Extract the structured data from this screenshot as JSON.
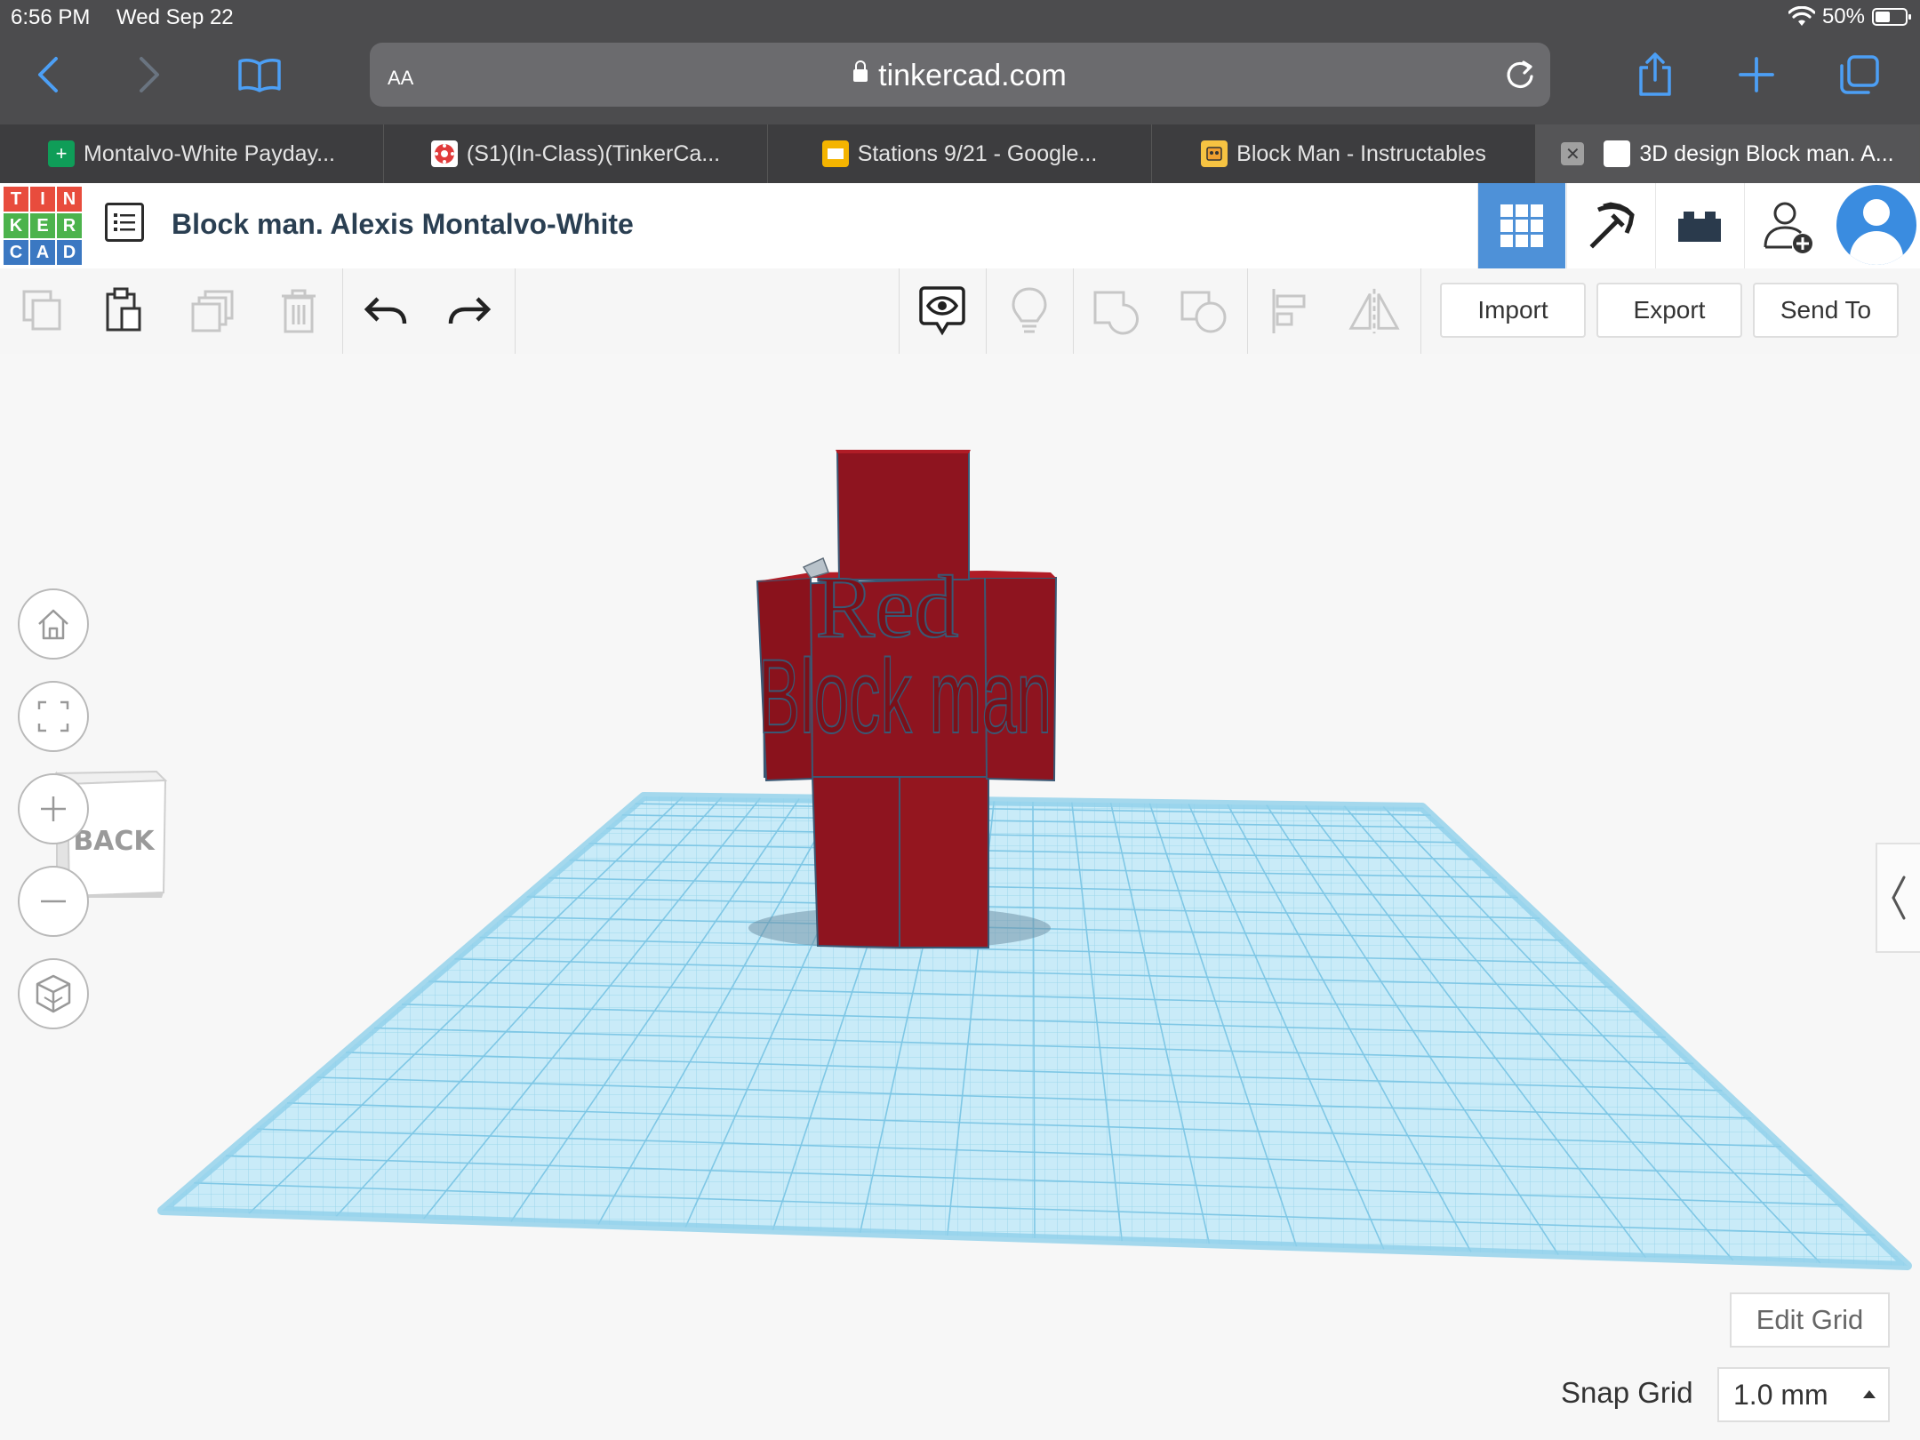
{
  "status_bar": {
    "time": "6:56 PM",
    "date": "Wed Sep 22",
    "battery": "50%",
    "battery_level": 0.5
  },
  "safari": {
    "aa_label": "AA",
    "url": "tinkercad.com",
    "icons": [
      "back-icon",
      "forward-icon",
      "bookmarks-icon",
      "reload-icon",
      "share-icon",
      "new-tab-icon",
      "tabs-overview-icon"
    ]
  },
  "tabs": [
    {
      "label": "Montalvo-White Payday...",
      "icon": "sheets-icon",
      "color": "#0f9d58"
    },
    {
      "label": "(S1)(In-Class)(TinkerCa...",
      "icon": "canvas-icon",
      "color": "#e13b3b"
    },
    {
      "label": "Stations 9/21 - Google...",
      "icon": "slides-icon",
      "color": "#f4b400"
    },
    {
      "label": "Block Man - Instructables",
      "icon": "instructables-icon",
      "color": "#f6c342"
    },
    {
      "label": "3D design Block man. A...",
      "icon": "tinkercad-icon",
      "active": true,
      "close": "✕"
    }
  ],
  "tinkercad": {
    "logo_letters": [
      "T",
      "I",
      "N",
      "K",
      "E",
      "R",
      "C",
      "A",
      "D"
    ],
    "logo_colors": [
      "#e84c3d",
      "#e84c3d",
      "#e84c3d",
      "#4cb34c",
      "#4cb34c",
      "#4cb34c",
      "#3b78c2",
      "#3b78c2",
      "#3b78c2"
    ],
    "design_title": "Block man. Alexis Montalvo-White",
    "accent": "#4e91d8"
  },
  "edit_toolbar": {
    "import_label": "Import",
    "export_label": "Export",
    "send_to_label": "Send To"
  },
  "workplane": {
    "view_cube_label": "BACK",
    "model_text_line1": "Red",
    "model_text_line2": "Block man",
    "model_color": "#8e141f",
    "grid_color": "#9fd7ee",
    "edit_grid_label": "Edit Grid",
    "snap_grid_label": "Snap Grid",
    "snap_grid_value": "1.0 mm"
  }
}
